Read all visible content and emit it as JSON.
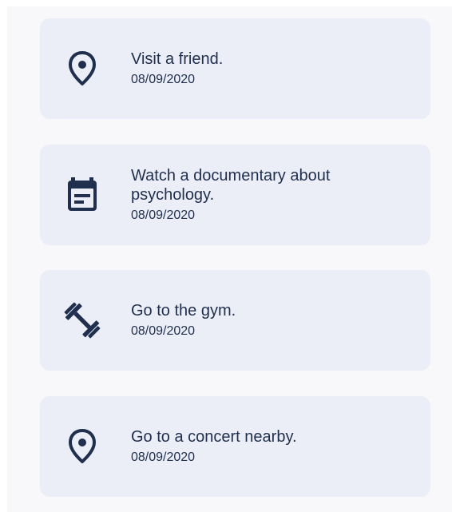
{
  "tasks": [
    {
      "title": "Visit a friend.",
      "date": "08/09/2020",
      "icon": "location-pin-icon"
    },
    {
      "title": "Watch a documentary about psychology.",
      "date": "08/09/2020",
      "icon": "calendar-icon"
    },
    {
      "title": "Go to the gym.",
      "date": "08/09/2020",
      "icon": "dumbbell-icon"
    },
    {
      "title": "Go to a concert nearby.",
      "date": "08/09/2020",
      "icon": "location-pin-icon"
    }
  ],
  "colors": {
    "card_background": "#eceef7",
    "text": "#1f2f4d",
    "icon": "#1f2f4d",
    "screen_background": "#f8f8fa"
  }
}
